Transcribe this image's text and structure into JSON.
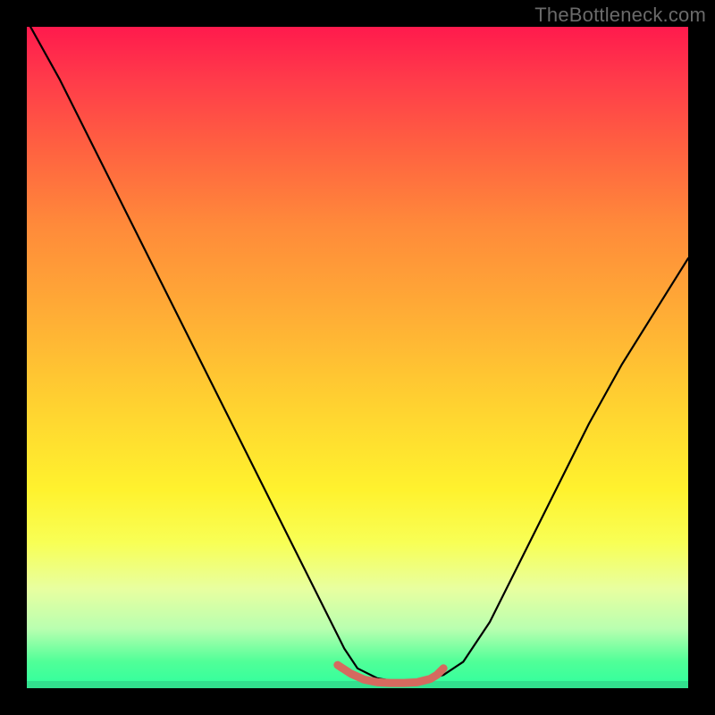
{
  "watermark": "TheBottleneck.com",
  "chart_data": {
    "type": "line",
    "title": "",
    "xlabel": "",
    "ylabel": "",
    "xlim": [
      0,
      100
    ],
    "ylim": [
      0,
      100
    ],
    "grid": false,
    "legend": false,
    "series": [
      {
        "name": "bottleneck-curve",
        "color": "#000000",
        "x": [
          0,
          5,
          10,
          15,
          20,
          25,
          30,
          35,
          40,
          45,
          48,
          50,
          53,
          56,
          58,
          60,
          63,
          66,
          70,
          75,
          80,
          85,
          90,
          95,
          100
        ],
        "values": [
          101,
          92,
          82,
          72,
          62,
          52,
          42,
          32,
          22,
          12,
          6,
          3,
          1.5,
          1.0,
          1.0,
          1.2,
          2.0,
          4,
          10,
          20,
          30,
          40,
          49,
          57,
          65
        ]
      },
      {
        "name": "valley-marker",
        "color": "#d56a5f",
        "x": [
          47,
          49,
          51,
          53,
          55,
          57,
          59,
          61,
          62,
          63
        ],
        "values": [
          3.5,
          2.2,
          1.3,
          0.9,
          0.8,
          0.8,
          0.9,
          1.4,
          2.0,
          3.0
        ]
      }
    ],
    "gradient_stops": [
      {
        "pos": 0.0,
        "color": "#ff1a4d"
      },
      {
        "pos": 0.08,
        "color": "#ff3b4a"
      },
      {
        "pos": 0.18,
        "color": "#ff6041"
      },
      {
        "pos": 0.3,
        "color": "#ff8a3a"
      },
      {
        "pos": 0.45,
        "color": "#ffb135"
      },
      {
        "pos": 0.58,
        "color": "#ffd430"
      },
      {
        "pos": 0.7,
        "color": "#fff22e"
      },
      {
        "pos": 0.78,
        "color": "#f8ff55"
      },
      {
        "pos": 0.85,
        "color": "#e8ffa0"
      },
      {
        "pos": 0.91,
        "color": "#b9ffb0"
      },
      {
        "pos": 0.96,
        "color": "#50ff98"
      },
      {
        "pos": 1.0,
        "color": "#2fff9e"
      }
    ]
  }
}
